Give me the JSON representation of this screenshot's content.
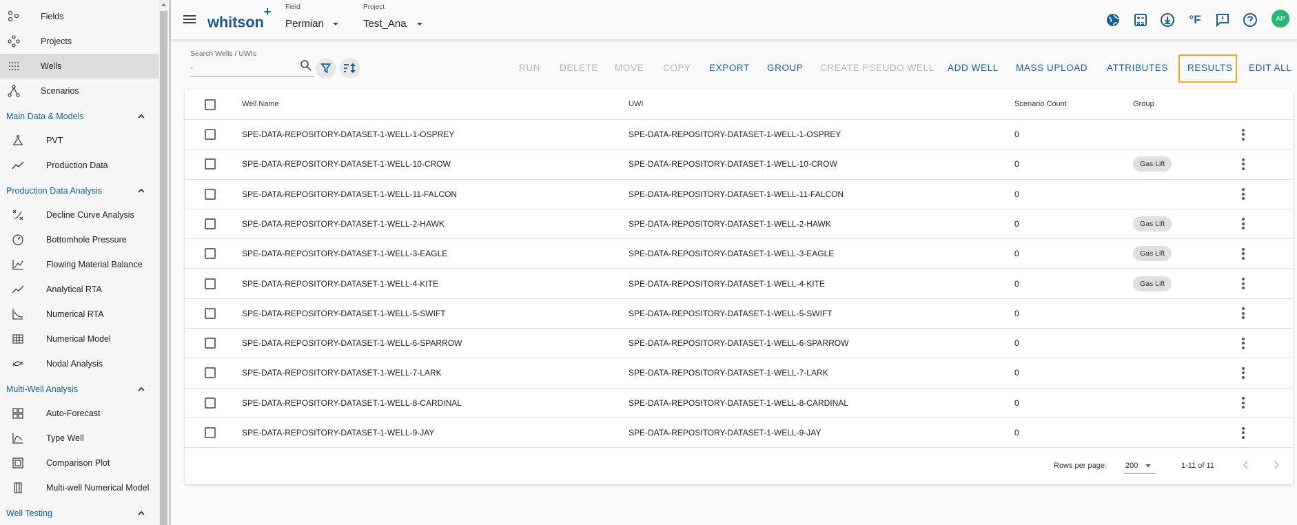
{
  "sidebar": {
    "items_top": [
      {
        "label": "Fields",
        "icon": "fields-icon"
      },
      {
        "label": "Projects",
        "icon": "projects-icon"
      },
      {
        "label": "Wells",
        "icon": "wells-icon",
        "active": true
      },
      {
        "label": "Scenarios",
        "icon": "scenarios-icon"
      }
    ],
    "sections": [
      {
        "label": "Main Data & Models",
        "items": [
          {
            "label": "PVT",
            "icon": "flask-icon"
          },
          {
            "label": "Production Data",
            "icon": "production-data-icon"
          }
        ]
      },
      {
        "label": "Production Data Analysis",
        "items": [
          {
            "label": "Decline Curve Analysis",
            "icon": "decline-curve-icon"
          },
          {
            "label": "Bottomhole Pressure",
            "icon": "gauge-icon"
          },
          {
            "label": "Flowing Material Balance",
            "icon": "material-balance-icon"
          },
          {
            "label": "Analytical RTA",
            "icon": "analytical-rta-icon"
          },
          {
            "label": "Numerical RTA",
            "icon": "numerical-rta-icon"
          },
          {
            "label": "Numerical Model",
            "icon": "numerical-model-icon"
          },
          {
            "label": "Nodal Analysis",
            "icon": "nodal-analysis-icon"
          }
        ]
      },
      {
        "label": "Multi-Well Analysis",
        "items": [
          {
            "label": "Auto-Forecast",
            "icon": "auto-forecast-icon"
          },
          {
            "label": "Type Well",
            "icon": "type-well-icon"
          },
          {
            "label": "Comparison Plot",
            "icon": "comparison-plot-icon"
          },
          {
            "label": "Multi-well Numerical Model",
            "icon": "multi-well-model-icon"
          }
        ]
      },
      {
        "label": "Well Testing",
        "items": []
      }
    ]
  },
  "header": {
    "logo": "whitson",
    "logo_plus": "+",
    "field_caption": "Field",
    "field_value": "Permian",
    "project_caption": "Project",
    "project_value": "Test_Ana",
    "unit_label": "°F",
    "avatar_initials": "AP"
  },
  "toolbar": {
    "search_label": "Search Wells / UWIs",
    "search_placeholder": "-",
    "buttons": [
      {
        "label": "RUN",
        "enabled": false
      },
      {
        "label": "DELETE",
        "enabled": false
      },
      {
        "label": "MOVE",
        "enabled": false
      },
      {
        "label": "COPY",
        "enabled": false
      },
      {
        "label": "EXPORT",
        "enabled": true
      },
      {
        "label": "GROUP",
        "enabled": true
      },
      {
        "label": "CREATE PSEUDO WELL",
        "enabled": false
      },
      {
        "label": "ADD WELL",
        "enabled": true
      },
      {
        "label": "MASS UPLOAD",
        "enabled": true
      },
      {
        "label": "ATTRIBUTES",
        "enabled": true
      },
      {
        "label": "RESULTS",
        "enabled": true,
        "highlighted": true
      },
      {
        "label": "EDIT ALL",
        "enabled": true
      }
    ]
  },
  "table": {
    "columns": [
      "Well Name",
      "UWI",
      "Scenario Count",
      "Group"
    ],
    "rows": [
      {
        "name": "SPE-DATA-REPOSITORY-DATASET-1-WELL-1-OSPREY",
        "uwi": "SPE-DATA-REPOSITORY-DATASET-1-WELL-1-OSPREY",
        "scenarios": "0",
        "group": ""
      },
      {
        "name": "SPE-DATA-REPOSITORY-DATASET-1-WELL-10-CROW",
        "uwi": "SPE-DATA-REPOSITORY-DATASET-1-WELL-10-CROW",
        "scenarios": "0",
        "group": "Gas Lift"
      },
      {
        "name": "SPE-DATA-REPOSITORY-DATASET-1-WELL-11-FALCON",
        "uwi": "SPE-DATA-REPOSITORY-DATASET-1-WELL-11-FALCON",
        "scenarios": "0",
        "group": ""
      },
      {
        "name": "SPE-DATA-REPOSITORY-DATASET-1-WELL-2-HAWK",
        "uwi": "SPE-DATA-REPOSITORY-DATASET-1-WELL-2-HAWK",
        "scenarios": "0",
        "group": "Gas Lift"
      },
      {
        "name": "SPE-DATA-REPOSITORY-DATASET-1-WELL-3-EAGLE",
        "uwi": "SPE-DATA-REPOSITORY-DATASET-1-WELL-3-EAGLE",
        "scenarios": "0",
        "group": "Gas Lift"
      },
      {
        "name": "SPE-DATA-REPOSITORY-DATASET-1-WELL-4-KITE",
        "uwi": "SPE-DATA-REPOSITORY-DATASET-1-WELL-4-KITE",
        "scenarios": "0",
        "group": "Gas Lift"
      },
      {
        "name": "SPE-DATA-REPOSITORY-DATASET-1-WELL-5-SWIFT",
        "uwi": "SPE-DATA-REPOSITORY-DATASET-1-WELL-5-SWIFT",
        "scenarios": "0",
        "group": ""
      },
      {
        "name": "SPE-DATA-REPOSITORY-DATASET-1-WELL-6-SPARROW",
        "uwi": "SPE-DATA-REPOSITORY-DATASET-1-WELL-6-SPARROW",
        "scenarios": "0",
        "group": ""
      },
      {
        "name": "SPE-DATA-REPOSITORY-DATASET-1-WELL-7-LARK",
        "uwi": "SPE-DATA-REPOSITORY-DATASET-1-WELL-7-LARK",
        "scenarios": "0",
        "group": ""
      },
      {
        "name": "SPE-DATA-REPOSITORY-DATASET-1-WELL-8-CARDINAL",
        "uwi": "SPE-DATA-REPOSITORY-DATASET-1-WELL-8-CARDINAL",
        "scenarios": "0",
        "group": ""
      },
      {
        "name": "SPE-DATA-REPOSITORY-DATASET-1-WELL-9-JAY",
        "uwi": "SPE-DATA-REPOSITORY-DATASET-1-WELL-9-JAY",
        "scenarios": "0",
        "group": ""
      }
    ],
    "footer": {
      "rows_per_page_label": "Rows per page:",
      "rows_per_page": "200",
      "range": "1-11 of 11"
    }
  },
  "colors": {
    "accent": "#1b5e91",
    "highlight": "#f5a623",
    "avatar": "#2bb673"
  }
}
